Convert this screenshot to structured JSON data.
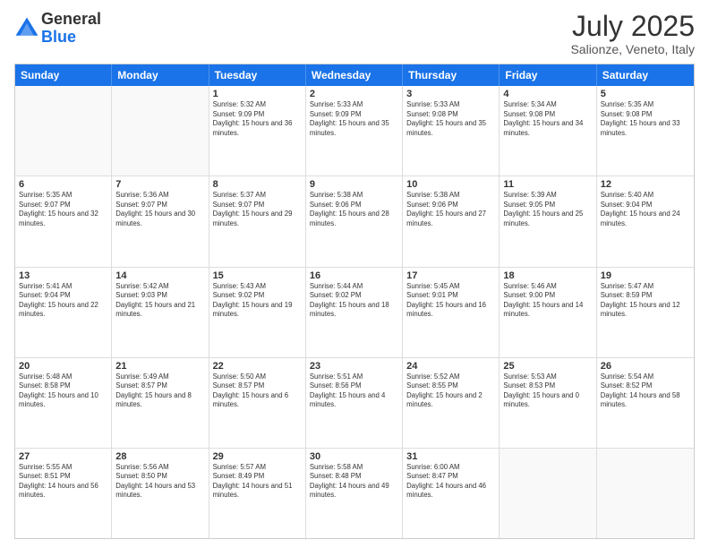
{
  "header": {
    "logo": {
      "general": "General",
      "blue": "Blue"
    },
    "title": "July 2025",
    "location": "Salionze, Veneto, Italy"
  },
  "calendar": {
    "weekdays": [
      "Sunday",
      "Monday",
      "Tuesday",
      "Wednesday",
      "Thursday",
      "Friday",
      "Saturday"
    ],
    "rows": [
      [
        {
          "day": "",
          "empty": true
        },
        {
          "day": "",
          "empty": true
        },
        {
          "day": "1",
          "sunrise": "Sunrise: 5:32 AM",
          "sunset": "Sunset: 9:09 PM",
          "daylight": "Daylight: 15 hours and 36 minutes."
        },
        {
          "day": "2",
          "sunrise": "Sunrise: 5:33 AM",
          "sunset": "Sunset: 9:09 PM",
          "daylight": "Daylight: 15 hours and 35 minutes."
        },
        {
          "day": "3",
          "sunrise": "Sunrise: 5:33 AM",
          "sunset": "Sunset: 9:08 PM",
          "daylight": "Daylight: 15 hours and 35 minutes."
        },
        {
          "day": "4",
          "sunrise": "Sunrise: 5:34 AM",
          "sunset": "Sunset: 9:08 PM",
          "daylight": "Daylight: 15 hours and 34 minutes."
        },
        {
          "day": "5",
          "sunrise": "Sunrise: 5:35 AM",
          "sunset": "Sunset: 9:08 PM",
          "daylight": "Daylight: 15 hours and 33 minutes."
        }
      ],
      [
        {
          "day": "6",
          "sunrise": "Sunrise: 5:35 AM",
          "sunset": "Sunset: 9:07 PM",
          "daylight": "Daylight: 15 hours and 32 minutes."
        },
        {
          "day": "7",
          "sunrise": "Sunrise: 5:36 AM",
          "sunset": "Sunset: 9:07 PM",
          "daylight": "Daylight: 15 hours and 30 minutes."
        },
        {
          "day": "8",
          "sunrise": "Sunrise: 5:37 AM",
          "sunset": "Sunset: 9:07 PM",
          "daylight": "Daylight: 15 hours and 29 minutes."
        },
        {
          "day": "9",
          "sunrise": "Sunrise: 5:38 AM",
          "sunset": "Sunset: 9:06 PM",
          "daylight": "Daylight: 15 hours and 28 minutes."
        },
        {
          "day": "10",
          "sunrise": "Sunrise: 5:38 AM",
          "sunset": "Sunset: 9:06 PM",
          "daylight": "Daylight: 15 hours and 27 minutes."
        },
        {
          "day": "11",
          "sunrise": "Sunrise: 5:39 AM",
          "sunset": "Sunset: 9:05 PM",
          "daylight": "Daylight: 15 hours and 25 minutes."
        },
        {
          "day": "12",
          "sunrise": "Sunrise: 5:40 AM",
          "sunset": "Sunset: 9:04 PM",
          "daylight": "Daylight: 15 hours and 24 minutes."
        }
      ],
      [
        {
          "day": "13",
          "sunrise": "Sunrise: 5:41 AM",
          "sunset": "Sunset: 9:04 PM",
          "daylight": "Daylight: 15 hours and 22 minutes."
        },
        {
          "day": "14",
          "sunrise": "Sunrise: 5:42 AM",
          "sunset": "Sunset: 9:03 PM",
          "daylight": "Daylight: 15 hours and 21 minutes."
        },
        {
          "day": "15",
          "sunrise": "Sunrise: 5:43 AM",
          "sunset": "Sunset: 9:02 PM",
          "daylight": "Daylight: 15 hours and 19 minutes."
        },
        {
          "day": "16",
          "sunrise": "Sunrise: 5:44 AM",
          "sunset": "Sunset: 9:02 PM",
          "daylight": "Daylight: 15 hours and 18 minutes."
        },
        {
          "day": "17",
          "sunrise": "Sunrise: 5:45 AM",
          "sunset": "Sunset: 9:01 PM",
          "daylight": "Daylight: 15 hours and 16 minutes."
        },
        {
          "day": "18",
          "sunrise": "Sunrise: 5:46 AM",
          "sunset": "Sunset: 9:00 PM",
          "daylight": "Daylight: 15 hours and 14 minutes."
        },
        {
          "day": "19",
          "sunrise": "Sunrise: 5:47 AM",
          "sunset": "Sunset: 8:59 PM",
          "daylight": "Daylight: 15 hours and 12 minutes."
        }
      ],
      [
        {
          "day": "20",
          "sunrise": "Sunrise: 5:48 AM",
          "sunset": "Sunset: 8:58 PM",
          "daylight": "Daylight: 15 hours and 10 minutes."
        },
        {
          "day": "21",
          "sunrise": "Sunrise: 5:49 AM",
          "sunset": "Sunset: 8:57 PM",
          "daylight": "Daylight: 15 hours and 8 minutes."
        },
        {
          "day": "22",
          "sunrise": "Sunrise: 5:50 AM",
          "sunset": "Sunset: 8:57 PM",
          "daylight": "Daylight: 15 hours and 6 minutes."
        },
        {
          "day": "23",
          "sunrise": "Sunrise: 5:51 AM",
          "sunset": "Sunset: 8:56 PM",
          "daylight": "Daylight: 15 hours and 4 minutes."
        },
        {
          "day": "24",
          "sunrise": "Sunrise: 5:52 AM",
          "sunset": "Sunset: 8:55 PM",
          "daylight": "Daylight: 15 hours and 2 minutes."
        },
        {
          "day": "25",
          "sunrise": "Sunrise: 5:53 AM",
          "sunset": "Sunset: 8:53 PM",
          "daylight": "Daylight: 15 hours and 0 minutes."
        },
        {
          "day": "26",
          "sunrise": "Sunrise: 5:54 AM",
          "sunset": "Sunset: 8:52 PM",
          "daylight": "Daylight: 14 hours and 58 minutes."
        }
      ],
      [
        {
          "day": "27",
          "sunrise": "Sunrise: 5:55 AM",
          "sunset": "Sunset: 8:51 PM",
          "daylight": "Daylight: 14 hours and 56 minutes."
        },
        {
          "day": "28",
          "sunrise": "Sunrise: 5:56 AM",
          "sunset": "Sunset: 8:50 PM",
          "daylight": "Daylight: 14 hours and 53 minutes."
        },
        {
          "day": "29",
          "sunrise": "Sunrise: 5:57 AM",
          "sunset": "Sunset: 8:49 PM",
          "daylight": "Daylight: 14 hours and 51 minutes."
        },
        {
          "day": "30",
          "sunrise": "Sunrise: 5:58 AM",
          "sunset": "Sunset: 8:48 PM",
          "daylight": "Daylight: 14 hours and 49 minutes."
        },
        {
          "day": "31",
          "sunrise": "Sunrise: 6:00 AM",
          "sunset": "Sunset: 8:47 PM",
          "daylight": "Daylight: 14 hours and 46 minutes."
        },
        {
          "day": "",
          "empty": true
        },
        {
          "day": "",
          "empty": true
        }
      ]
    ]
  }
}
